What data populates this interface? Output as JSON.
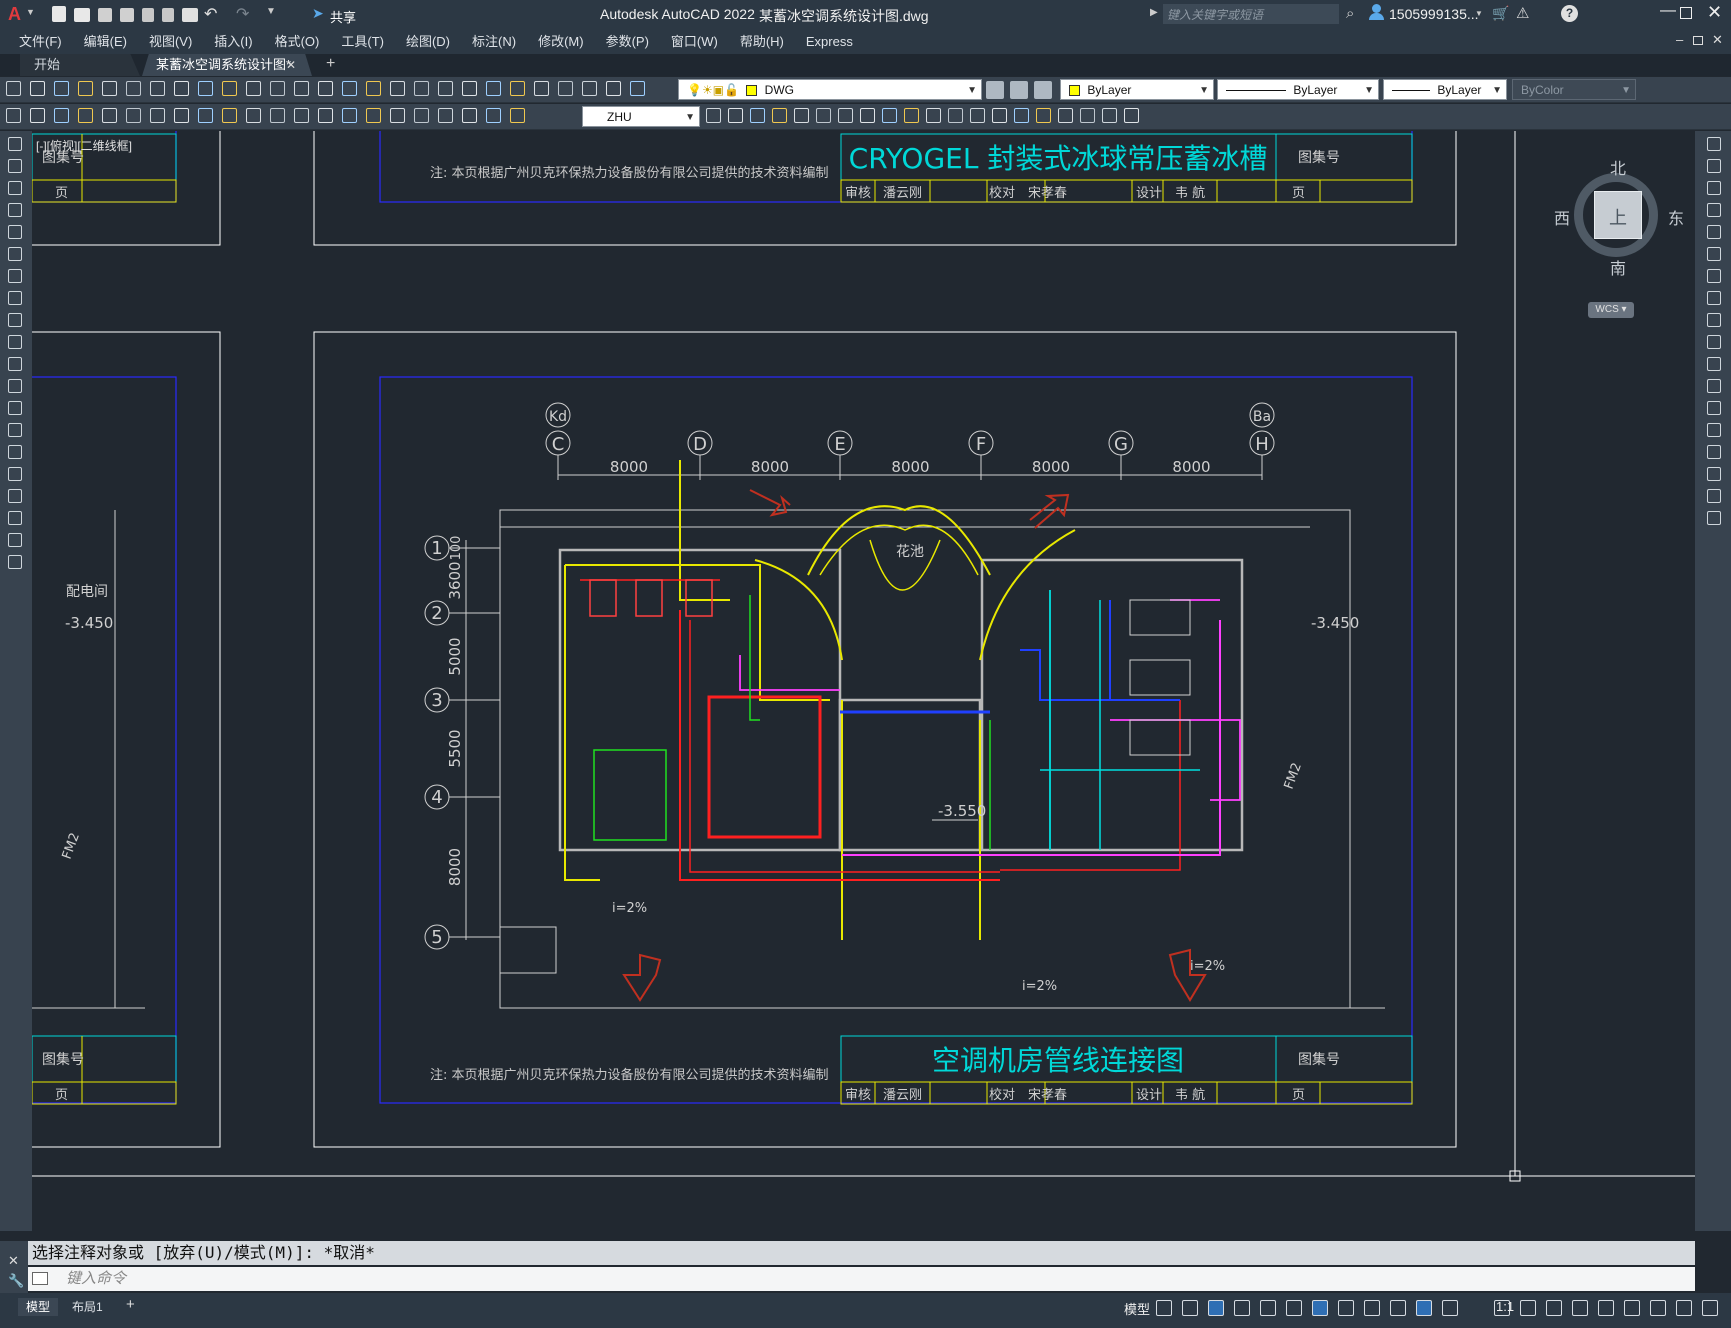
{
  "titlebar": {
    "app_title": "Autodesk AutoCAD 2022",
    "file_title": "某蓄冰空调系统设计图.dwg",
    "share": "共享",
    "search_placeholder": "键入关键字或短语",
    "user": "1505999135..."
  },
  "menu": [
    "文件(F)",
    "编辑(E)",
    "视图(V)",
    "插入(I)",
    "格式(O)",
    "工具(T)",
    "绘图(D)",
    "标注(N)",
    "修改(M)",
    "参数(P)",
    "窗口(W)",
    "帮助(H)",
    "Express"
  ],
  "tabs": {
    "start": "开始",
    "active": "某蓄冰空调系统设计图*"
  },
  "toolbar": {
    "layer": "DWG",
    "color": "ByLayer",
    "linetype": "ByLayer",
    "lineweight": "ByLayer",
    "plotstyle": "ByColor",
    "textstyle": "ZHU"
  },
  "viewport_label": "[-][俯视][二维线框]",
  "viewcube": {
    "north": "北",
    "south": "南",
    "east": "东",
    "west": "西",
    "top": "上",
    "wcs": "WCS"
  },
  "drawing": {
    "top_title": "CRYOGEL 封装式冰球常压蓄冰槽",
    "bottom_title": "空调机房管线连接图",
    "note": "注: 本页根据广州贝克环保热力设备股份有限公司提供的技术资料编制",
    "atlas_no": "图集号",
    "page": "页",
    "reviewer_label": "审核",
    "reviewer": "潘云刚",
    "checker_label": "校对",
    "checker": "宋孝春",
    "designer_label": "设计",
    "designer": "韦 航",
    "axis_cols": [
      "C",
      "D",
      "E",
      "F",
      "G",
      "H"
    ],
    "axis_top": [
      "Kd",
      "Ba"
    ],
    "dims": [
      "8000",
      "8000",
      "8000",
      "8000",
      "8000"
    ],
    "axis_rows": [
      "1",
      "2",
      "3",
      "4",
      "5"
    ],
    "row_dims": [
      "3600",
      "5000",
      "5500",
      "8000"
    ],
    "row_dim_top": "100",
    "garden": "花池",
    "level_main": "-3.550",
    "level_side": "-3.450",
    "slope": "i=2%",
    "room_left": "配电间",
    "fm": "FM2"
  },
  "command": {
    "history": "选择注释对象或 [放弃(U)/模式(M)]: *取消*",
    "placeholder": "键入命令"
  },
  "status": {
    "model_tab": "模型",
    "layout_tab": "布局1",
    "model_btn": "模型",
    "scale": "1:1"
  }
}
